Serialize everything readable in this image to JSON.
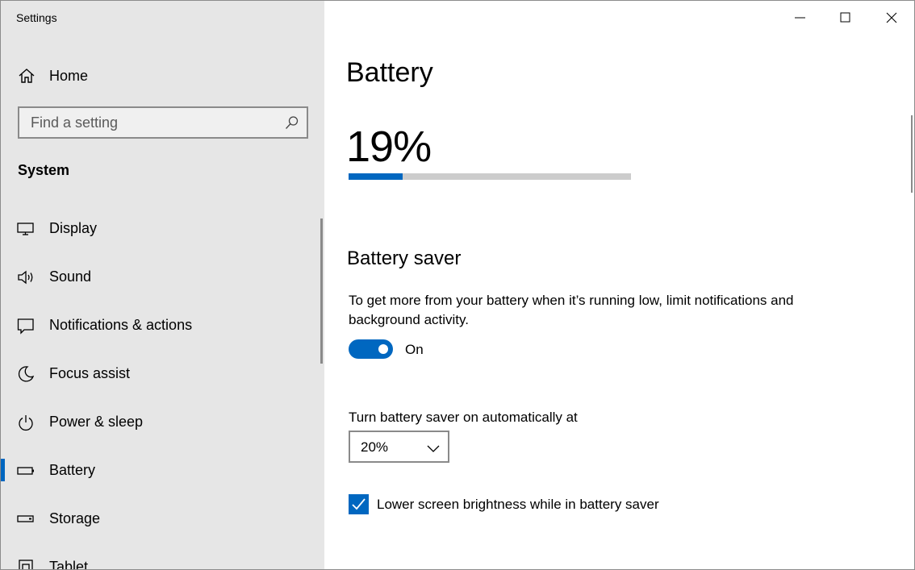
{
  "window": {
    "title": "Settings",
    "controls": [
      "minimize",
      "maximize",
      "close"
    ]
  },
  "sidebar": {
    "home_label": "Home",
    "search": {
      "placeholder": "Find a setting"
    },
    "section_heading": "System",
    "items": [
      {
        "label": "Display",
        "icon": "display-icon"
      },
      {
        "label": "Sound",
        "icon": "speaker-icon"
      },
      {
        "label": "Notifications & actions",
        "icon": "notification-icon"
      },
      {
        "label": "Focus assist",
        "icon": "moon-icon"
      },
      {
        "label": "Power & sleep",
        "icon": "power-icon"
      },
      {
        "label": "Battery",
        "icon": "battery-icon",
        "selected": true
      },
      {
        "label": "Storage",
        "icon": "storage-icon"
      },
      {
        "label": "Tablet",
        "icon": "tablet-icon"
      }
    ]
  },
  "main": {
    "title": "Battery",
    "percent": "19%",
    "progress_fraction": 0.19,
    "battery_saver": {
      "heading": "Battery saver",
      "description": "To get more from your battery when it’s running low, limit notifications and background activity.",
      "toggle_state": "On",
      "auto_label": "Turn battery saver on automatically at",
      "threshold": "20%",
      "brightness_label": "Lower screen brightness while in battery saver",
      "brightness_checked": true
    }
  },
  "colors": {
    "accent": "#0067c0",
    "sidebar_bg": "#e6e6e6",
    "track": "#cccccc"
  }
}
